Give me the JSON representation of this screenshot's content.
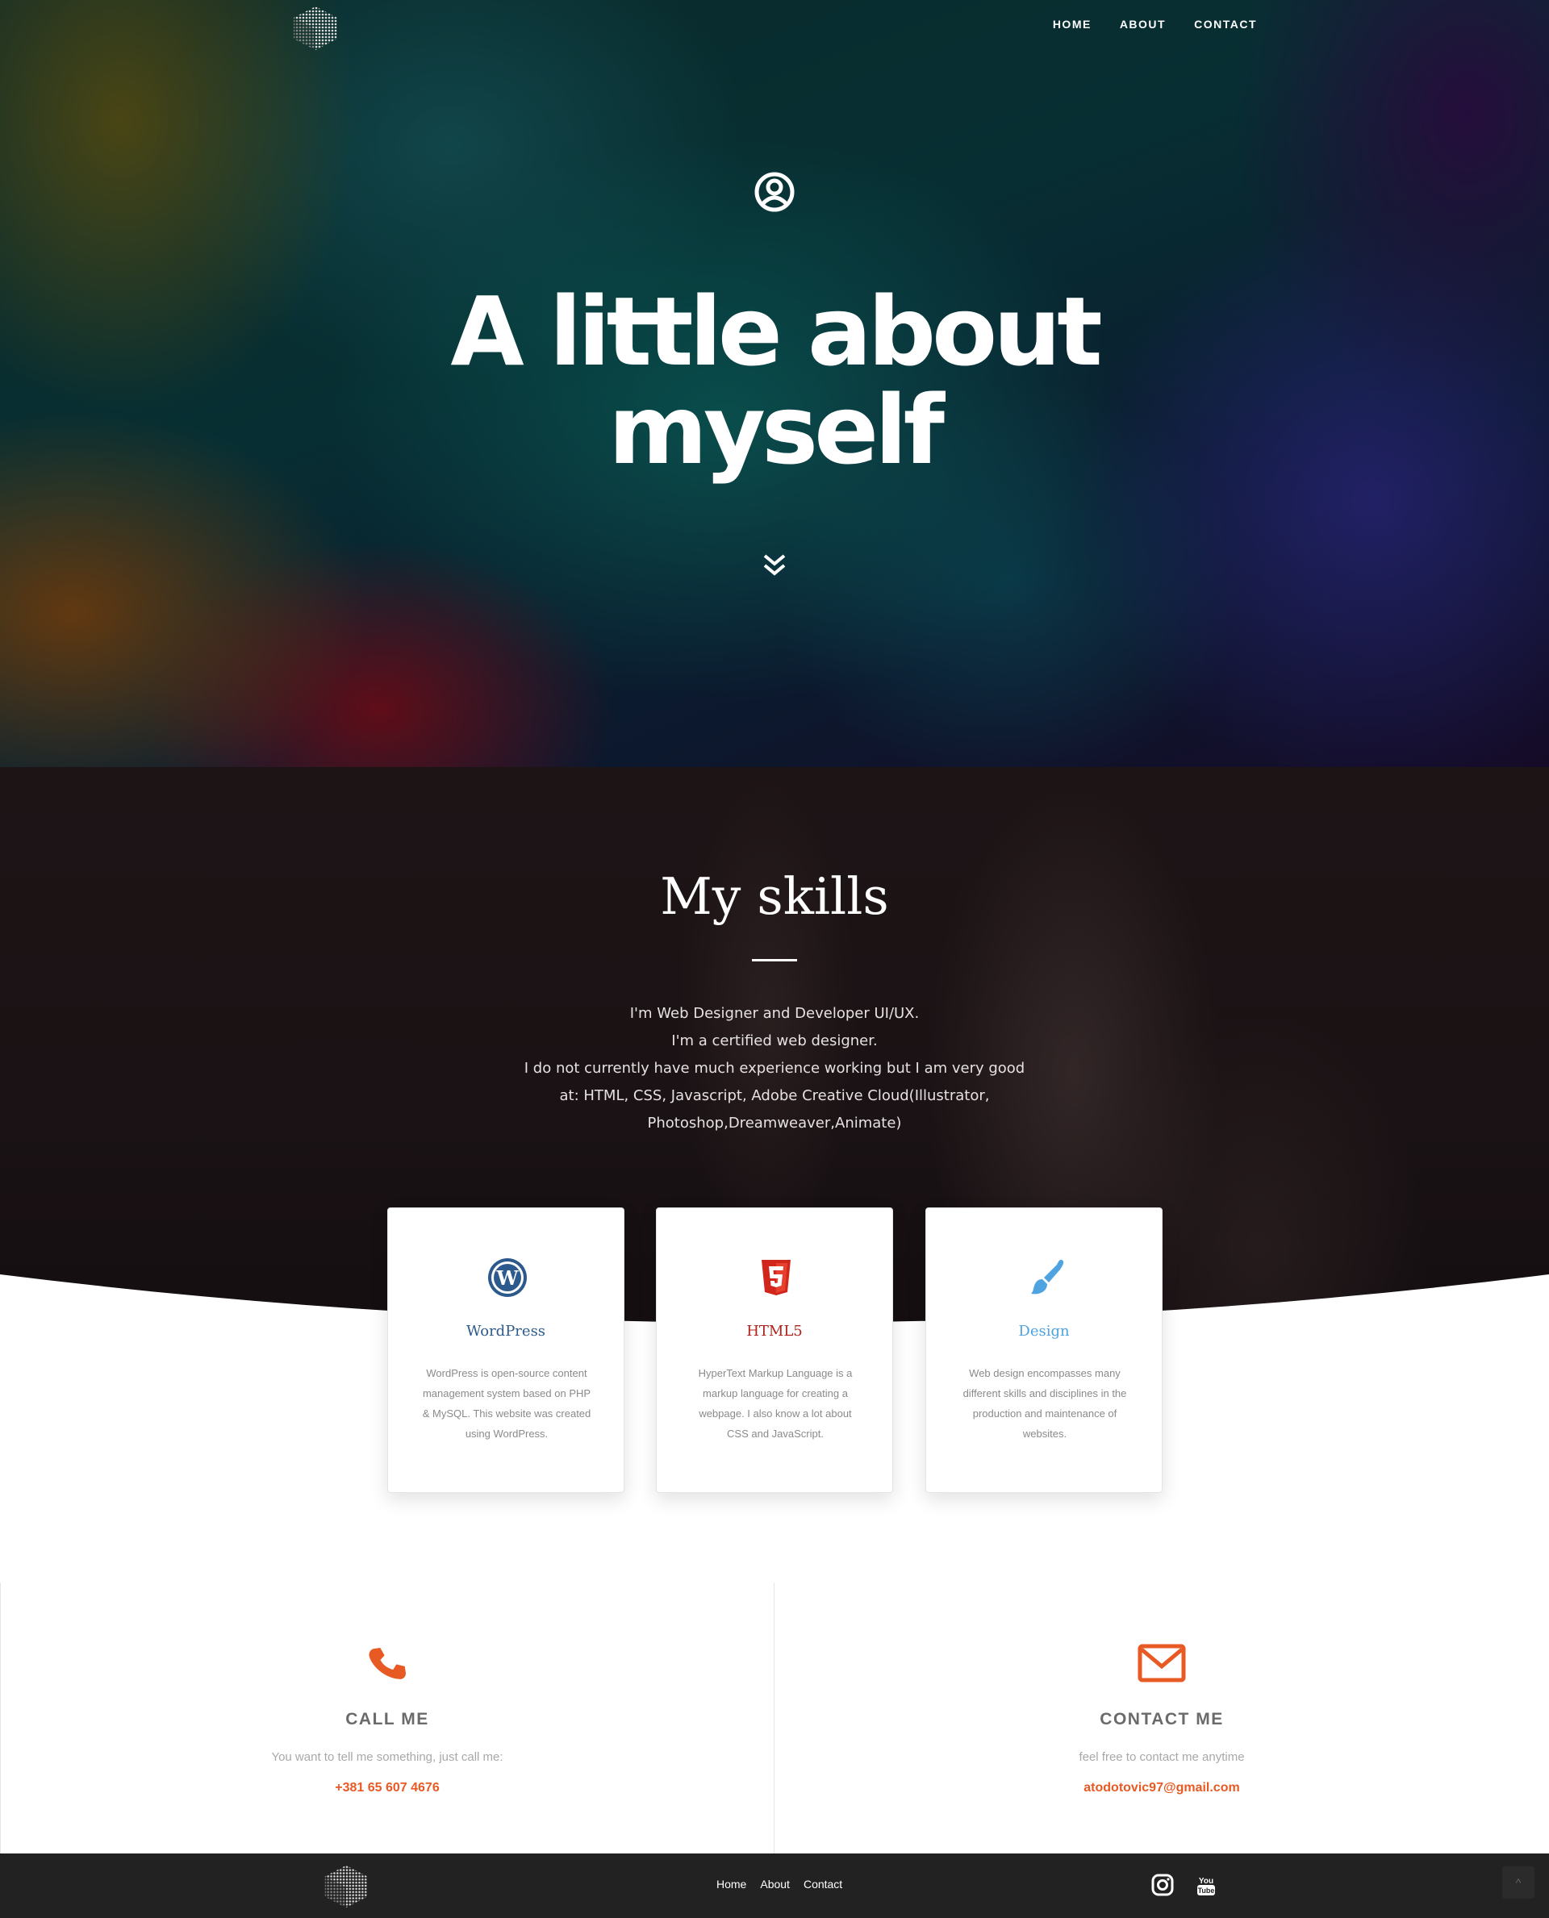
{
  "header": {
    "nav": [
      {
        "label": "HOME"
      },
      {
        "label": "ABOUT"
      },
      {
        "label": "CONTACT"
      }
    ]
  },
  "hero": {
    "title_line1": "A little about",
    "title_line2": "myself",
    "icons": [
      "user-circle-icon",
      "double-chevron-down-icon"
    ]
  },
  "skills": {
    "title": "My skills",
    "paragraph": [
      "I'm Web Designer and Developer UI/UX.",
      "I'm a certified web designer.",
      "I do not currently have much experience working but I am very good",
      "at:  HTML,  CSS,  Javascript,  Adobe Creative Cloud(Illustrator,",
      "Photoshop,Dreamweaver,Animate)"
    ],
    "cards": [
      {
        "title": "WordPress",
        "icon": "wordpress-icon",
        "text": "WordPress is open-source content management system based on PHP & MySQL. This website was created using WordPress."
      },
      {
        "title": "HTML5",
        "icon": "html5-icon",
        "text": "HyperText Markup Language is a markup language for creating a webpage. I also know a lot about CSS and JavaScript."
      },
      {
        "title": "Design",
        "icon": "brush-icon",
        "text": "Web design encompasses many different skills and disciplines in the production and maintenance of websites."
      }
    ]
  },
  "contact": {
    "call": {
      "title": "CALL ME",
      "text": "You want to tell me something, just call me:",
      "value": "+381 65 607 4676",
      "icon": "phone-icon"
    },
    "mail": {
      "title": "CONTACT ME",
      "text": "feel free to contact me anytime",
      "value": "atodotovic97@gmail.com",
      "icon": "envelope-icon"
    }
  },
  "footer": {
    "nav": [
      {
        "label": "Home"
      },
      {
        "label": "About"
      },
      {
        "label": "Contact"
      }
    ],
    "social": [
      "instagram-icon",
      "youtube-icon"
    ],
    "to_top": "^"
  },
  "colors": {
    "accent": "#e85a24",
    "wordpress": "#2d5a8c",
    "html5": "#b0211b",
    "design": "#4ea3e0",
    "footer_bg": "#222222"
  }
}
